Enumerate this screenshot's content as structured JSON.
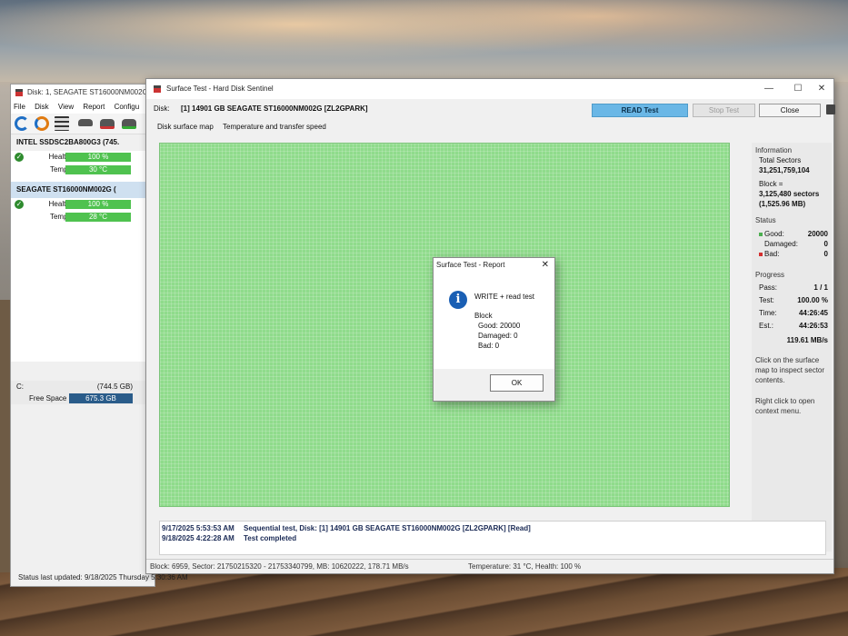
{
  "main_window": {
    "title": "Disk: 1, SEAGATE ST16000NM002G",
    "menu": [
      "File",
      "Disk",
      "View",
      "Report",
      "Configu"
    ],
    "disks": [
      {
        "name": "INTEL SSDSC2BA800G3 (745.",
        "health_label": "Health:",
        "health": "100 %",
        "temp_label": "Temp.:",
        "temp": "30 °C"
      },
      {
        "name": "SEAGATE ST16000NM002G (",
        "health_label": "Health:",
        "health": "100 %",
        "temp_label": "Temp.:",
        "temp": "28 °C"
      }
    ],
    "volume": {
      "drive": "C:",
      "size": "(744.5 GB)",
      "free_label": "Free Space",
      "free": "675.3 GB"
    },
    "status": "Status last updated: 9/18/2025 Thursday 5:30:36 AM"
  },
  "surface_test": {
    "title": "Surface Test - Hard Disk Sentinel",
    "disk_label": "Disk:",
    "disk_name": "[1] 14901 GB  SEAGATE ST16000NM002G [ZL2GPARK]",
    "read_test": "READ Test",
    "stop_test": "Stop Test",
    "close": "Close",
    "tabs": [
      "Disk surface map",
      "Temperature and transfer speed"
    ],
    "info": {
      "title": "Information",
      "total_sectors_label": "Total Sectors",
      "total_sectors": "31,251,759,104",
      "block_label": "Block =",
      "block_sectors": "3,125,480 sectors",
      "block_mb": "(1,525.96 MB)"
    },
    "status_sec": {
      "title": "Status",
      "good_label": "Good:",
      "good": "20000",
      "damaged_label": "Damaged:",
      "damaged": "0",
      "bad_label": "Bad:",
      "bad": "0",
      "good_color": "#4caf50",
      "bad_color": "#d32f2f"
    },
    "progress": {
      "title": "Progress",
      "pass_label": "Pass:",
      "pass": "1 / 1",
      "test_label": "Test:",
      "test": "100.00 %",
      "time_label": "Time:",
      "time": "44:26:45",
      "est_label": "Est.:",
      "est": "44:26:53",
      "speed": "119.61 MB/s"
    },
    "hints": [
      "Click on the surface",
      "map to inspect sector",
      "contents.",
      "Right click to open",
      "context menu."
    ],
    "log": [
      {
        "time": "9/17/2025   5:53:53 AM",
        "msg": "Sequential test, Disk: [1] 14901 GB  SEAGATE ST16000NM002G [ZL2GPARK] [Read]"
      },
      {
        "time": "9/18/2025   4:22:28 AM",
        "msg": "Test completed"
      }
    ],
    "statusbar": {
      "block": "Block: 6959, Sector: 21750215320 - 21753340799, MB: 10620222, 178.71 MB/s",
      "temp": "Temperature: 31 °C,  Health: 100 %"
    }
  },
  "report": {
    "title": "Surface Test - Report",
    "heading": "WRITE + read test",
    "block_label": "Block",
    "good": "Good: 20000",
    "damaged": "Damaged: 0",
    "bad": "Bad: 0",
    "ok": "OK"
  }
}
